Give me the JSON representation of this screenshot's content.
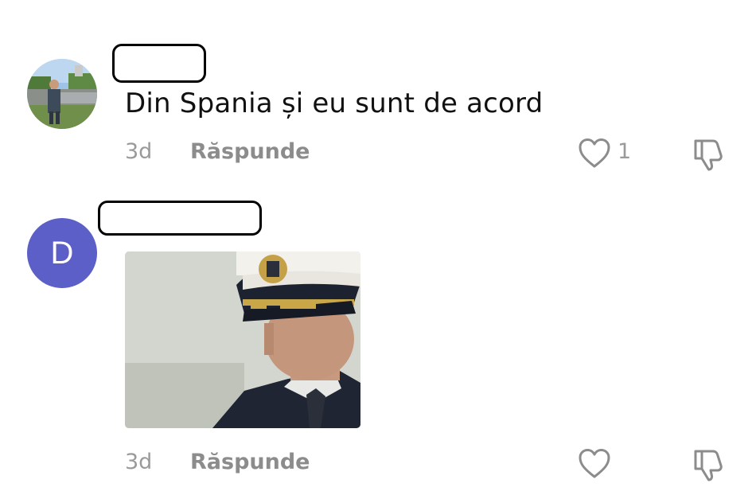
{
  "comments": [
    {
      "avatar": "photo-avatar",
      "text": "Din Spania și eu sunt de acord",
      "time": "3d",
      "reply_label": "Răspunde",
      "like_count": "1",
      "like_icon": "heart-icon",
      "dislike_icon": "thumbs-down-icon"
    },
    {
      "avatar_letter": "D",
      "avatar_color": "#5b5fc7",
      "media": "gif-image",
      "time": "3d",
      "reply_label": "Răspunde",
      "like_icon": "heart-icon",
      "dislike_icon": "thumbs-down-icon"
    }
  ],
  "colors": {
    "meta_gray": "#9a9a9a",
    "text": "#111111"
  }
}
